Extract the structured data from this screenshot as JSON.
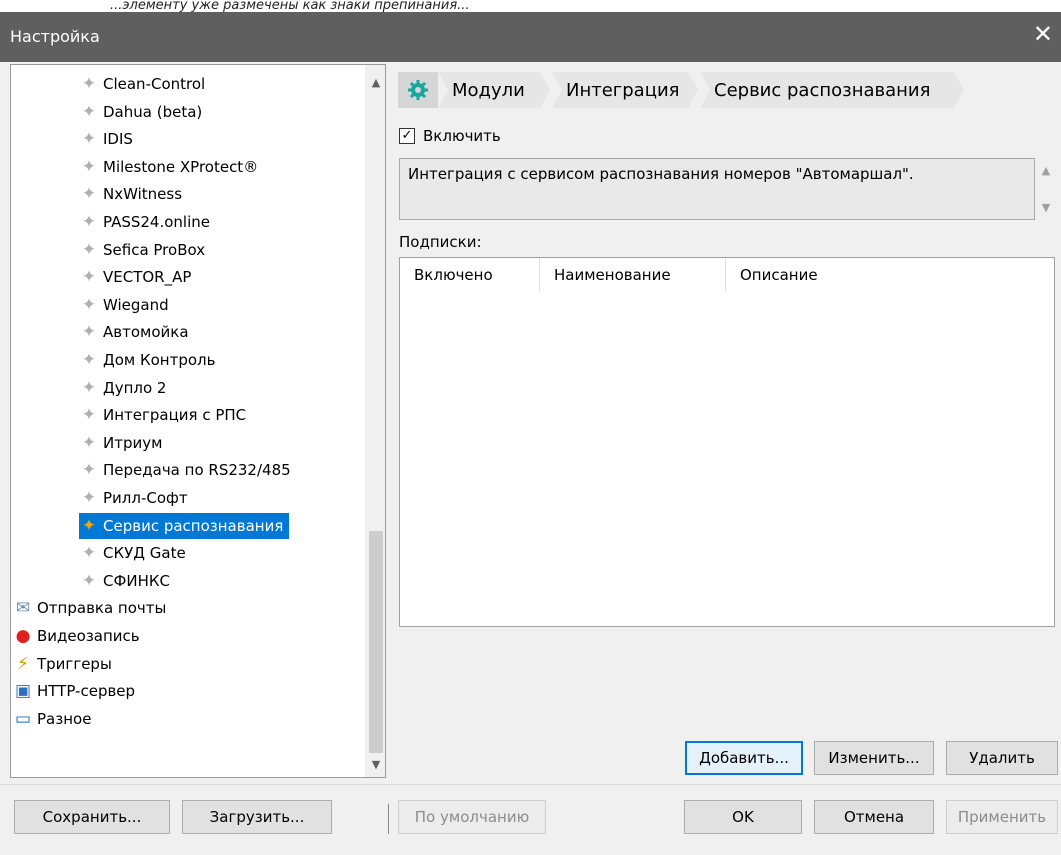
{
  "top_strip": "...элементу уже размечены как знаки препинания...",
  "window": {
    "title": "Настройка",
    "close_glyph": "✕"
  },
  "tree": {
    "items": [
      {
        "label": "Clean-Control",
        "icon": "plugin-icon",
        "level": 2
      },
      {
        "label": "Dahua (beta)",
        "icon": "plugin-icon",
        "level": 2
      },
      {
        "label": "IDIS",
        "icon": "plugin-icon",
        "level": 2
      },
      {
        "label": "Milestone XProtect®",
        "icon": "plugin-icon",
        "level": 2
      },
      {
        "label": "NxWitness",
        "icon": "plugin-icon",
        "level": 2
      },
      {
        "label": "PASS24.online",
        "icon": "plugin-icon",
        "level": 2
      },
      {
        "label": "Sefica ProBox",
        "icon": "plugin-icon",
        "level": 2
      },
      {
        "label": "VECTOR_AP",
        "icon": "plugin-icon",
        "level": 2
      },
      {
        "label": "Wiegand",
        "icon": "plugin-icon",
        "level": 2
      },
      {
        "label": "Автомойка",
        "icon": "plugin-icon",
        "level": 2
      },
      {
        "label": "Дом Контроль",
        "icon": "plugin-icon",
        "level": 2
      },
      {
        "label": "Дупло 2",
        "icon": "plugin-icon",
        "level": 2
      },
      {
        "label": "Интеграция с РПС",
        "icon": "plugin-icon",
        "level": 2
      },
      {
        "label": "Итриум",
        "icon": "plugin-icon",
        "level": 2
      },
      {
        "label": "Передача по RS232/485",
        "icon": "plugin-icon",
        "level": 2
      },
      {
        "label": "Рилл-Софт",
        "icon": "plugin-icon",
        "level": 2
      },
      {
        "label": "Сервис распознавания",
        "icon": "plugin-active-icon",
        "level": 2,
        "selected": true
      },
      {
        "label": "СКУД Gate",
        "icon": "plugin-icon",
        "level": 2
      },
      {
        "label": "СФИНКС",
        "icon": "plugin-icon",
        "level": 2
      },
      {
        "label": "Отправка почты",
        "icon": "mail-icon",
        "level": 1
      },
      {
        "label": "Видеозапись",
        "icon": "video-record-icon",
        "level": 1
      },
      {
        "label": "Триггеры",
        "icon": "trigger-icon",
        "level": 1
      },
      {
        "label": "HTTP-сервер",
        "icon": "http-server-icon",
        "level": 1
      },
      {
        "label": "Разное",
        "icon": "window-icon",
        "level": 1
      }
    ]
  },
  "breadcrumb": {
    "home_icon": "gear-icon",
    "items": [
      "Модули",
      "Интеграция",
      "Сервис распознавания"
    ]
  },
  "enable": {
    "label": "Включить",
    "checked": true,
    "check_glyph": "✓"
  },
  "description": "Интеграция с сервисом распознавания номеров \"Автомаршал\".",
  "subscriptions": {
    "label": "Подписки:",
    "columns": [
      "Включено",
      "Наименование",
      "Описание"
    ]
  },
  "subs_buttons": {
    "add": "Добавить...",
    "edit": "Изменить...",
    "delete": "Удалить"
  },
  "footer": {
    "save": "Сохранить...",
    "load": "Загрузить...",
    "default": "По умолчанию",
    "ok": "OK",
    "cancel": "Отмена",
    "apply": "Применить"
  },
  "colors": {
    "selection": "#0078d7",
    "titlebar": "#5f5f5f",
    "gear": "#19a5a0"
  }
}
